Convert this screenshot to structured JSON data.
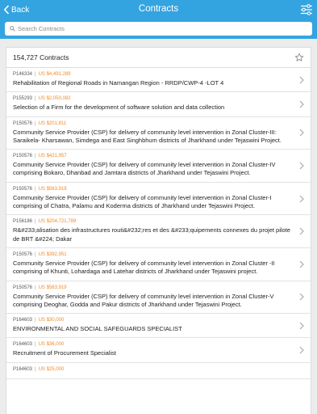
{
  "header": {
    "back_label": "Back",
    "title": "Contracts"
  },
  "search": {
    "placeholder": "Search Contracts"
  },
  "list": {
    "count_label": "154,727 Contracts",
    "items": [
      {
        "project_id": "P146334",
        "amount": "US $4,491,289",
        "name": "Rehabilitation of Regional Roads in Namangan Region - RRDP/CWP-4 -LOT 4"
      },
      {
        "project_id": "P155293",
        "amount": "US $2,050,082",
        "name": "Selection of a Firm for the development of software solution and data collection"
      },
      {
        "project_id": "P150576",
        "amount": "US $201,811",
        "name": "Community Service Provider (CSP) for delivery of community level intervention in Zonal Cluster-III: Saraikela- Kharsawan, Simdega and East Singhbhum districts of Jharkhand under Tejaswini Project."
      },
      {
        "project_id": "P150576",
        "amount": "US $421,957",
        "name": "Community Service Provider (CSP) for delivery of community level intervention in Zonal Cluster-IV comprising Bokaro, Dhanbad and Jamtara districts of Jharkhand under Tejaswini Project."
      },
      {
        "project_id": "P150576",
        "amount": "US $563,919",
        "name": "Community Service Provider (CSP) for delivery of community level intervention in Zonal Cluster-I comprising of Chatra, Palamu and Koderma districts of Jharkhand under Tejaswini Project."
      },
      {
        "project_id": "P156186",
        "amount": "US $204,721,789",
        "name": "R&#233;alisation des infrastructures routi&#232;res et des &#233;quipements connexes du projet pilote de BRT &#224; Dakar"
      },
      {
        "project_id": "P150576",
        "amount": "US $392,951",
        "name": "Community Service Provider (CSP) for delivery of community level intervention in Zonal Cluster -II comprising of Khunti, Lohardaga and Latehar districts of Jharkhand under Tejaswini project."
      },
      {
        "project_id": "P150576",
        "amount": "US $563,919",
        "name": "Community Service Provider (CSP) for delivery of community level intervention in Zonal Cluster-V comprising Deoghar, Godda and Pakur districts of Jharkhand under Tejaswini Project."
      },
      {
        "project_id": "P164603",
        "amount": "US $30,000",
        "name": "ENVIRONMENTAL AND SOCIAL SAFEGUARDS SPECIALIST"
      },
      {
        "project_id": "P164603",
        "amount": "US $36,000",
        "name": "Recruitment of Procurement Specialist"
      },
      {
        "project_id": "P164603",
        "amount": "US $25,000",
        "name": ""
      }
    ]
  },
  "colors": {
    "header_bg": "#34a4e0",
    "amount": "#f08a24"
  },
  "icons": {
    "back": "chevron-left-icon",
    "filter": "sliders-icon",
    "search": "search-icon",
    "favorite": "star-icon",
    "row": "chevron-right-icon"
  }
}
